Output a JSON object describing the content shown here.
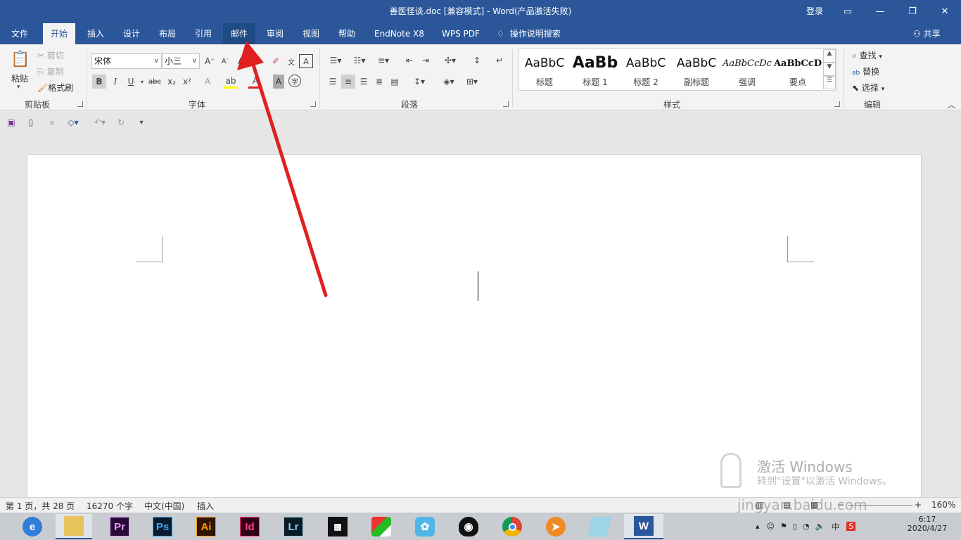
{
  "window": {
    "title": "善医怪谈.doc [兼容模式]  -  Word(产品激活失败)",
    "login": "登录",
    "controls": [
      "ribbon-display-options",
      "minimize",
      "restore",
      "close"
    ]
  },
  "tabs": [
    {
      "label": "文件"
    },
    {
      "label": "开始",
      "active": true
    },
    {
      "label": "插入"
    },
    {
      "label": "设计"
    },
    {
      "label": "布局"
    },
    {
      "label": "引用"
    },
    {
      "label": "邮件",
      "highlighted": true
    },
    {
      "label": "审阅"
    },
    {
      "label": "视图"
    },
    {
      "label": "帮助"
    },
    {
      "label": "EndNote X8"
    },
    {
      "label": "WPS PDF"
    }
  ],
  "tell_me": "操作说明搜索",
  "share": "共享",
  "ribbon": {
    "clipboard": {
      "label": "剪贴板",
      "paste": "粘贴",
      "cut": "剪切",
      "copy": "复制",
      "format_painter": "格式刷"
    },
    "font": {
      "label": "字体",
      "font_name": "宋体",
      "font_size": "小三"
    },
    "paragraph": {
      "label": "段落"
    },
    "styles": {
      "label": "样式",
      "items": [
        {
          "sample": "AaBbC",
          "name": "标题"
        },
        {
          "sample": "AaBb",
          "name": "标题 1"
        },
        {
          "sample": "AaBbC",
          "name": "标题 2"
        },
        {
          "sample": "AaBbC",
          "name": "副标题"
        },
        {
          "sample": "AaBbCcDc",
          "name": "强调"
        },
        {
          "sample": "AaBbCcD",
          "name": "要点"
        }
      ]
    },
    "editing": {
      "label": "编辑",
      "find": "查找",
      "replace": "替换",
      "select": "选择"
    }
  },
  "status": {
    "page": "第 1 页，共 28 页",
    "words": "16270 个字",
    "language": "中文(中国)",
    "mode": "插入",
    "zoom": "160%"
  },
  "taskbar": {
    "apps": [
      "edge",
      "file-explorer",
      "Pr",
      "Ps",
      "Ai",
      "Id",
      "Lr",
      "video-editor",
      "photo-app",
      "bird-app",
      "qq",
      "chrome",
      "app-orange",
      "notes",
      "word"
    ],
    "time": "6:17",
    "date": "2020/4/27",
    "ime": "中"
  },
  "watermark": {
    "line1": "激活 Windows",
    "line2": "转到\"设置\"以激活 Windows。",
    "site": "jingyan.baidu.com"
  },
  "colors": {
    "accent": "#2b579a",
    "arrow": "#e02020"
  }
}
